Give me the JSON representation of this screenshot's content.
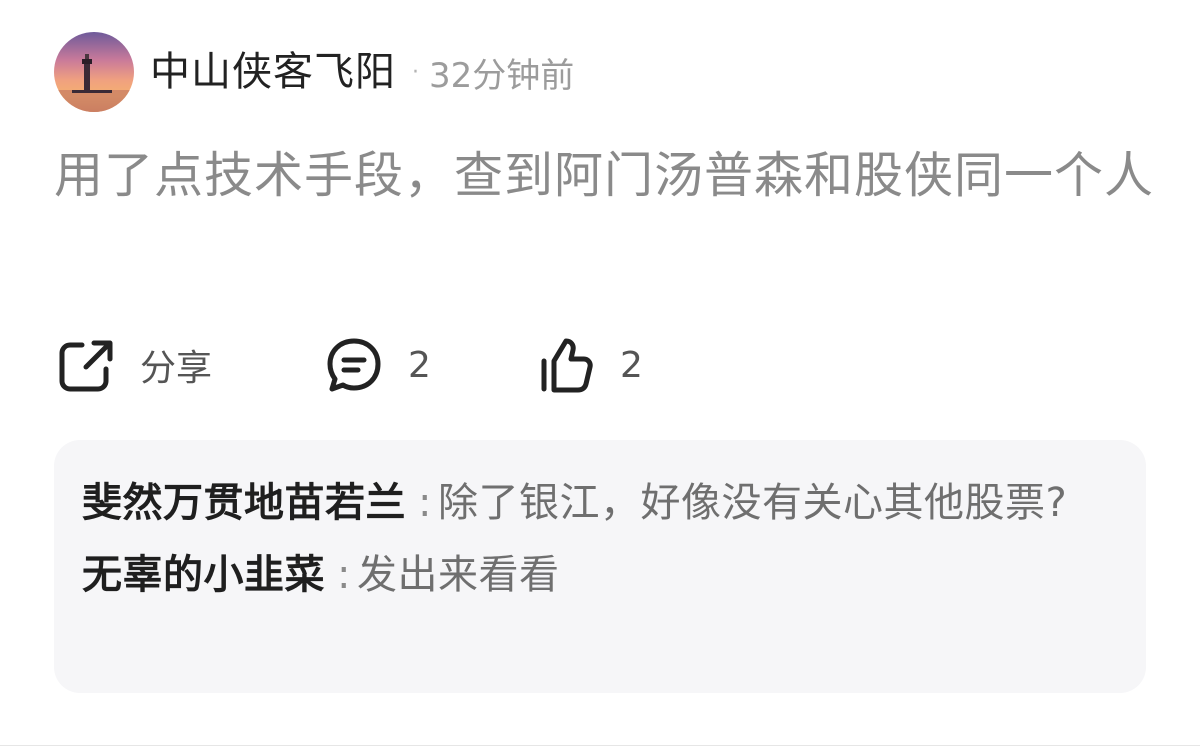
{
  "post": {
    "username": "中山侠客飞阳",
    "dot": "·",
    "time": "32分钟前",
    "content": "用了点技术手段，查到阿门汤普森和股侠同一个人",
    "avatar_icon": "lighthouse-sunset-avatar"
  },
  "actions": {
    "share": {
      "icon": "share-icon",
      "label": "分享"
    },
    "comment": {
      "icon": "comment-icon",
      "count": "2"
    },
    "like": {
      "icon": "thumbs-up-icon",
      "count": "2"
    }
  },
  "comments": [
    {
      "author": "斐然万贯地苗若兰",
      "separator": ":",
      "text": "除了银江，好像没有关心其他股票?"
    },
    {
      "author": "无辜的小韭菜",
      "separator": ":",
      "text": "发出来看看"
    }
  ],
  "colors": {
    "username": "#222222",
    "meta": "#9c9c9c",
    "content": "#8a8a8a",
    "comment_bg": "#f6f6f8"
  }
}
